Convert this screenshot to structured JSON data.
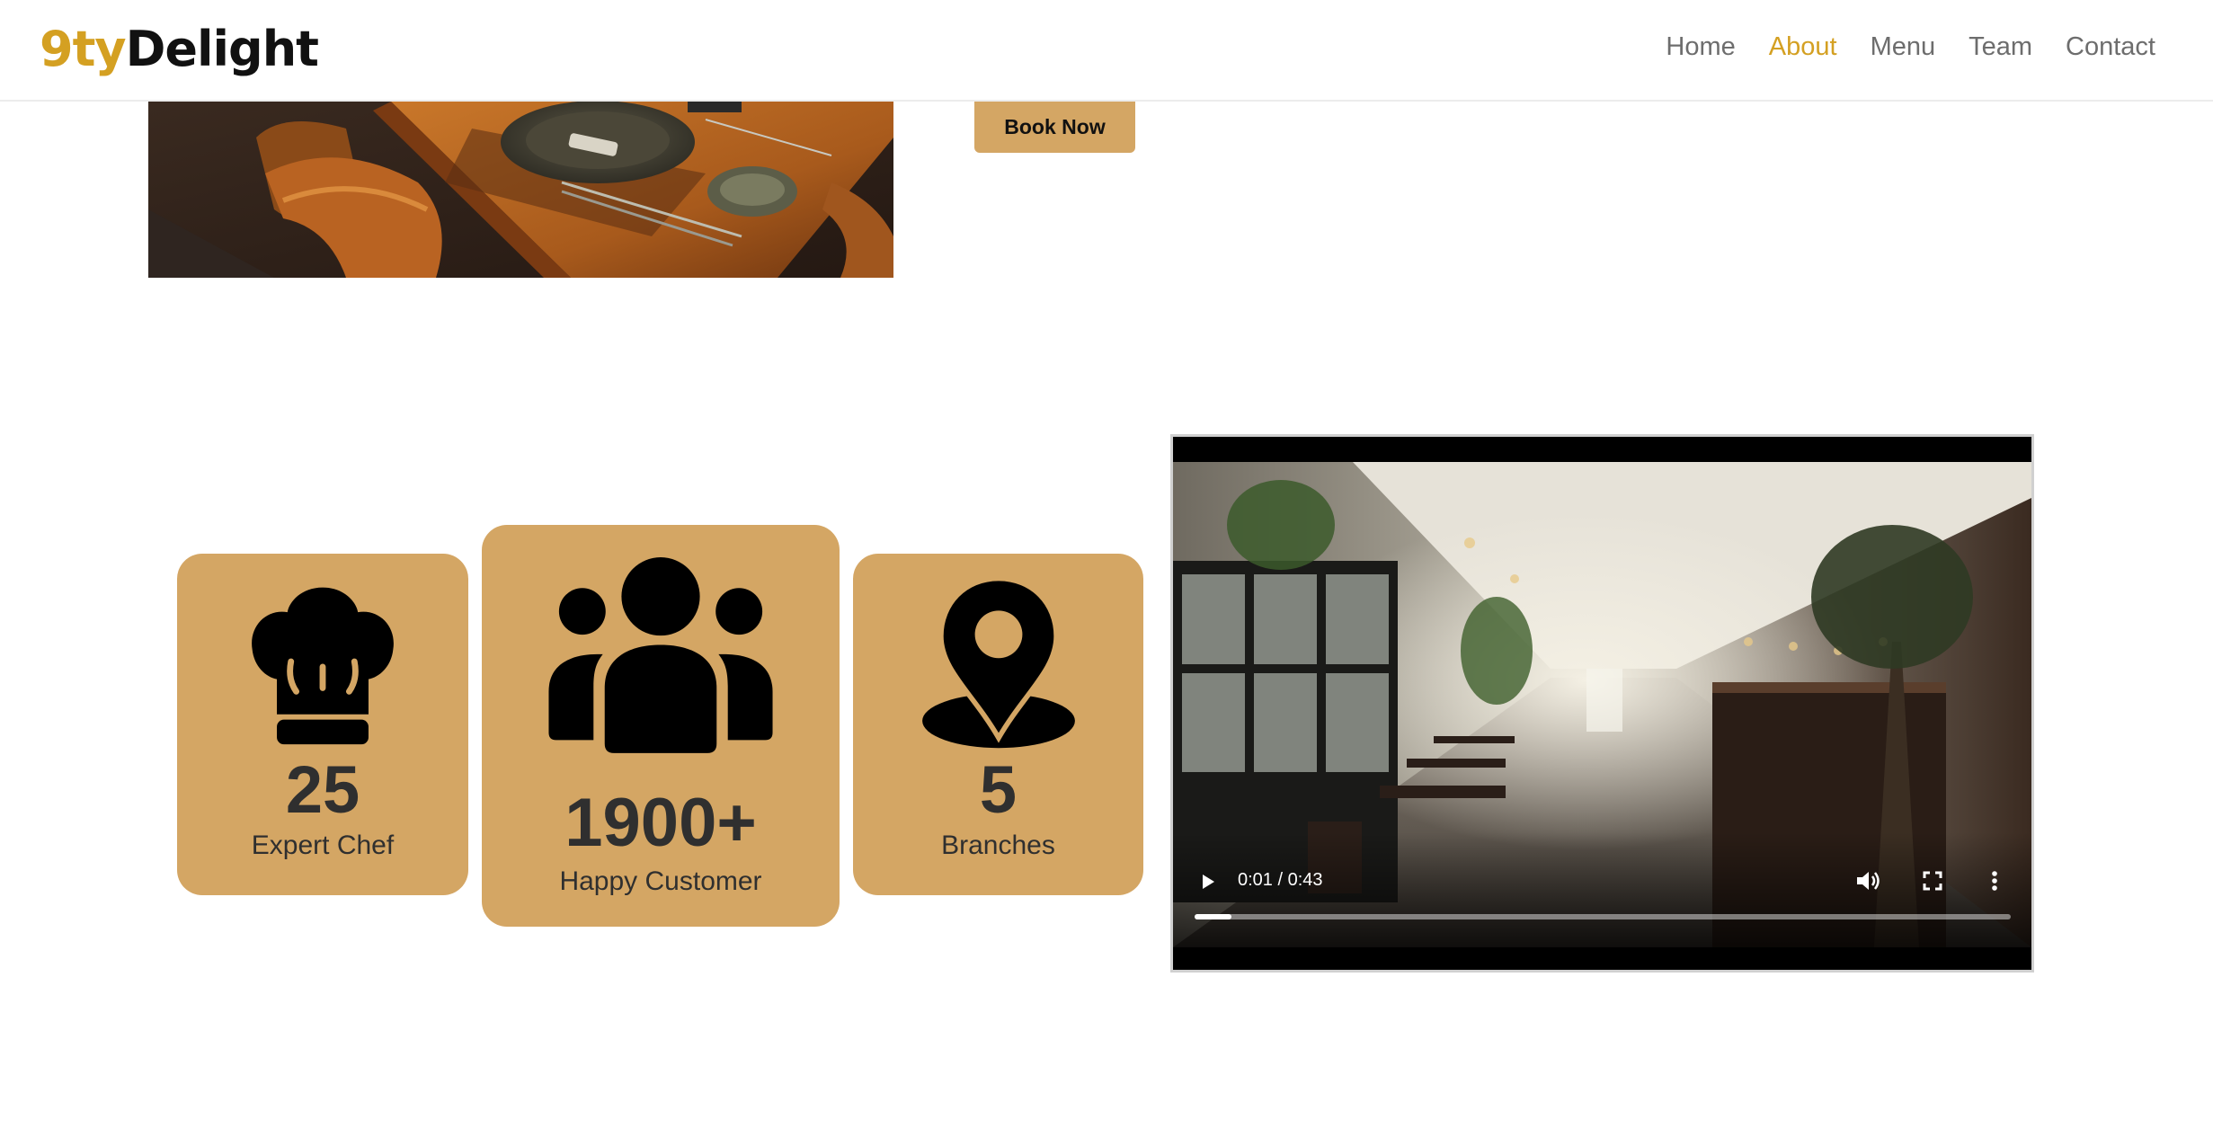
{
  "header": {
    "logo_accent": "9ty",
    "logo_main": "Delight",
    "nav": [
      {
        "label": "Home",
        "active": false
      },
      {
        "label": "About",
        "active": true
      },
      {
        "label": "Menu",
        "active": false
      },
      {
        "label": "Team",
        "active": false
      },
      {
        "label": "Contact",
        "active": false
      }
    ]
  },
  "hero": {
    "book_button": "Book Now"
  },
  "stats": [
    {
      "icon": "chef-hat-icon",
      "value": "25",
      "label": "Expert Chef"
    },
    {
      "icon": "group-icon",
      "value": "1900+",
      "label": "Happy Customer"
    },
    {
      "icon": "location-pin-icon",
      "value": "5",
      "label": "Branches"
    }
  ],
  "video": {
    "time_display": "0:01 / 0:43",
    "progress_fraction": 0.045
  },
  "colors": {
    "accent": "#d4a022",
    "card_bg": "#d4a664",
    "nav_text": "#6d6d6d"
  }
}
